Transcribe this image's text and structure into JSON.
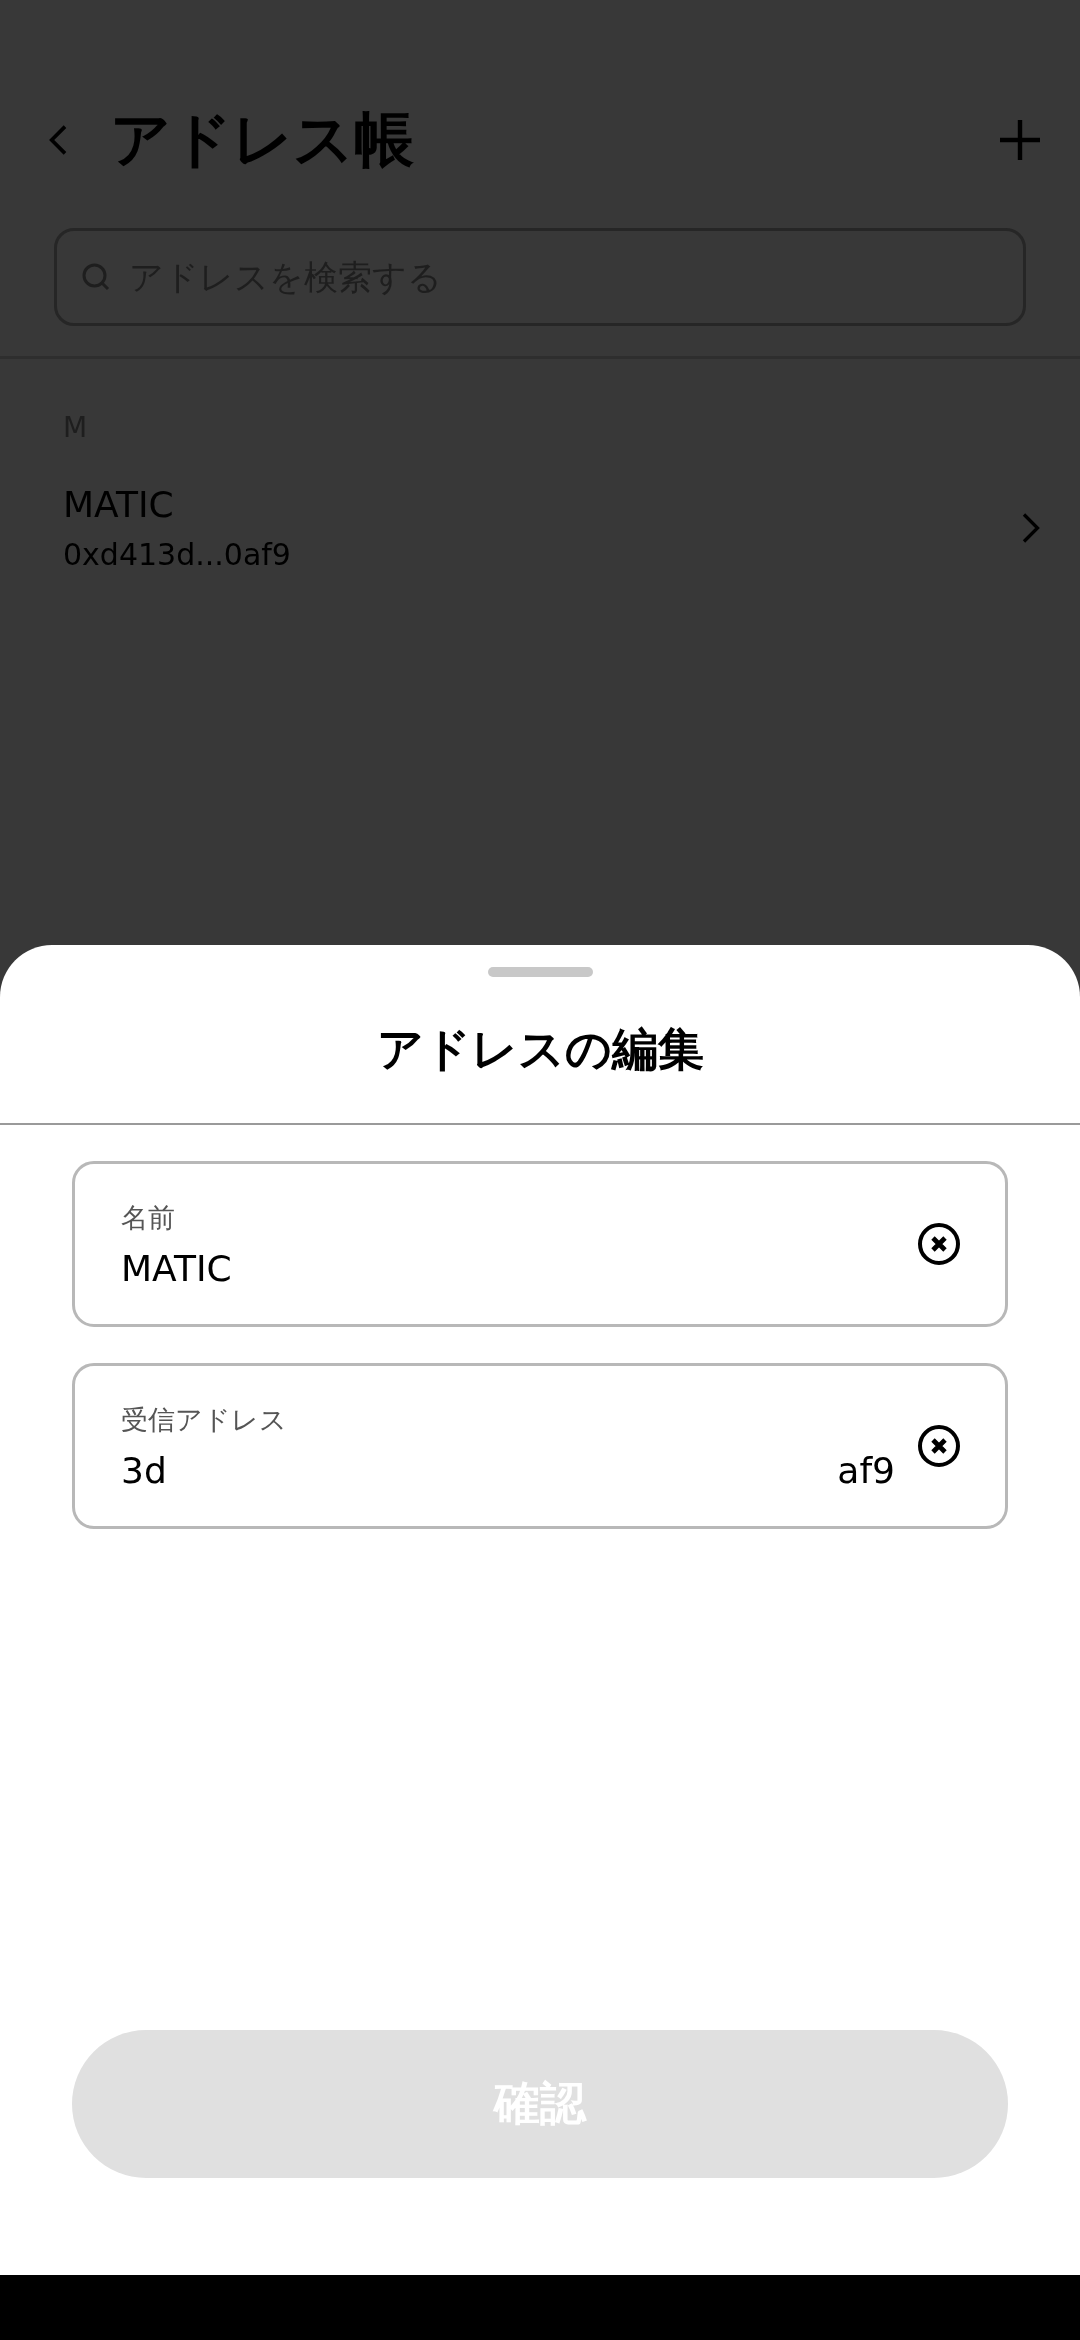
{
  "header": {
    "title": "アドレス帳"
  },
  "search": {
    "placeholder": "アドレスを検索する"
  },
  "sections": [
    {
      "letter": "M",
      "entries": [
        {
          "name": "MATIC",
          "address": "0xd413d...0af9"
        }
      ]
    }
  ],
  "sheet": {
    "title": "アドレスの編集",
    "fields": [
      {
        "label": "名前",
        "value": "MATIC"
      },
      {
        "label": "受信アドレス",
        "value_start": "3d",
        "value_end": "af9"
      }
    ],
    "confirm": {
      "label": "確認",
      "disabled": true
    }
  }
}
